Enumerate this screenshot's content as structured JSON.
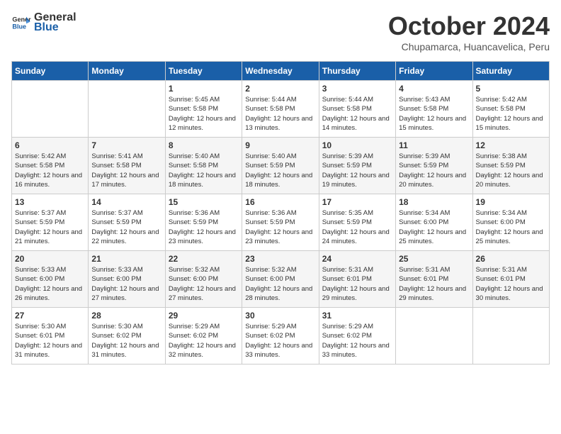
{
  "logo": {
    "general": "General",
    "blue": "Blue"
  },
  "title": "October 2024",
  "location": "Chupamarca, Huancavelica, Peru",
  "days_of_week": [
    "Sunday",
    "Monday",
    "Tuesday",
    "Wednesday",
    "Thursday",
    "Friday",
    "Saturday"
  ],
  "weeks": [
    [
      {
        "day": "",
        "sunrise": "",
        "sunset": "",
        "daylight": ""
      },
      {
        "day": "",
        "sunrise": "",
        "sunset": "",
        "daylight": ""
      },
      {
        "day": "1",
        "sunrise": "Sunrise: 5:45 AM",
        "sunset": "Sunset: 5:58 PM",
        "daylight": "Daylight: 12 hours and 12 minutes."
      },
      {
        "day": "2",
        "sunrise": "Sunrise: 5:44 AM",
        "sunset": "Sunset: 5:58 PM",
        "daylight": "Daylight: 12 hours and 13 minutes."
      },
      {
        "day": "3",
        "sunrise": "Sunrise: 5:44 AM",
        "sunset": "Sunset: 5:58 PM",
        "daylight": "Daylight: 12 hours and 14 minutes."
      },
      {
        "day": "4",
        "sunrise": "Sunrise: 5:43 AM",
        "sunset": "Sunset: 5:58 PM",
        "daylight": "Daylight: 12 hours and 15 minutes."
      },
      {
        "day": "5",
        "sunrise": "Sunrise: 5:42 AM",
        "sunset": "Sunset: 5:58 PM",
        "daylight": "Daylight: 12 hours and 15 minutes."
      }
    ],
    [
      {
        "day": "6",
        "sunrise": "Sunrise: 5:42 AM",
        "sunset": "Sunset: 5:58 PM",
        "daylight": "Daylight: 12 hours and 16 minutes."
      },
      {
        "day": "7",
        "sunrise": "Sunrise: 5:41 AM",
        "sunset": "Sunset: 5:58 PM",
        "daylight": "Daylight: 12 hours and 17 minutes."
      },
      {
        "day": "8",
        "sunrise": "Sunrise: 5:40 AM",
        "sunset": "Sunset: 5:58 PM",
        "daylight": "Daylight: 12 hours and 18 minutes."
      },
      {
        "day": "9",
        "sunrise": "Sunrise: 5:40 AM",
        "sunset": "Sunset: 5:59 PM",
        "daylight": "Daylight: 12 hours and 18 minutes."
      },
      {
        "day": "10",
        "sunrise": "Sunrise: 5:39 AM",
        "sunset": "Sunset: 5:59 PM",
        "daylight": "Daylight: 12 hours and 19 minutes."
      },
      {
        "day": "11",
        "sunrise": "Sunrise: 5:39 AM",
        "sunset": "Sunset: 5:59 PM",
        "daylight": "Daylight: 12 hours and 20 minutes."
      },
      {
        "day": "12",
        "sunrise": "Sunrise: 5:38 AM",
        "sunset": "Sunset: 5:59 PM",
        "daylight": "Daylight: 12 hours and 20 minutes."
      }
    ],
    [
      {
        "day": "13",
        "sunrise": "Sunrise: 5:37 AM",
        "sunset": "Sunset: 5:59 PM",
        "daylight": "Daylight: 12 hours and 21 minutes."
      },
      {
        "day": "14",
        "sunrise": "Sunrise: 5:37 AM",
        "sunset": "Sunset: 5:59 PM",
        "daylight": "Daylight: 12 hours and 22 minutes."
      },
      {
        "day": "15",
        "sunrise": "Sunrise: 5:36 AM",
        "sunset": "Sunset: 5:59 PM",
        "daylight": "Daylight: 12 hours and 23 minutes."
      },
      {
        "day": "16",
        "sunrise": "Sunrise: 5:36 AM",
        "sunset": "Sunset: 5:59 PM",
        "daylight": "Daylight: 12 hours and 23 minutes."
      },
      {
        "day": "17",
        "sunrise": "Sunrise: 5:35 AM",
        "sunset": "Sunset: 5:59 PM",
        "daylight": "Daylight: 12 hours and 24 minutes."
      },
      {
        "day": "18",
        "sunrise": "Sunrise: 5:34 AM",
        "sunset": "Sunset: 6:00 PM",
        "daylight": "Daylight: 12 hours and 25 minutes."
      },
      {
        "day": "19",
        "sunrise": "Sunrise: 5:34 AM",
        "sunset": "Sunset: 6:00 PM",
        "daylight": "Daylight: 12 hours and 25 minutes."
      }
    ],
    [
      {
        "day": "20",
        "sunrise": "Sunrise: 5:33 AM",
        "sunset": "Sunset: 6:00 PM",
        "daylight": "Daylight: 12 hours and 26 minutes."
      },
      {
        "day": "21",
        "sunrise": "Sunrise: 5:33 AM",
        "sunset": "Sunset: 6:00 PM",
        "daylight": "Daylight: 12 hours and 27 minutes."
      },
      {
        "day": "22",
        "sunrise": "Sunrise: 5:32 AM",
        "sunset": "Sunset: 6:00 PM",
        "daylight": "Daylight: 12 hours and 27 minutes."
      },
      {
        "day": "23",
        "sunrise": "Sunrise: 5:32 AM",
        "sunset": "Sunset: 6:00 PM",
        "daylight": "Daylight: 12 hours and 28 minutes."
      },
      {
        "day": "24",
        "sunrise": "Sunrise: 5:31 AM",
        "sunset": "Sunset: 6:01 PM",
        "daylight": "Daylight: 12 hours and 29 minutes."
      },
      {
        "day": "25",
        "sunrise": "Sunrise: 5:31 AM",
        "sunset": "Sunset: 6:01 PM",
        "daylight": "Daylight: 12 hours and 29 minutes."
      },
      {
        "day": "26",
        "sunrise": "Sunrise: 5:31 AM",
        "sunset": "Sunset: 6:01 PM",
        "daylight": "Daylight: 12 hours and 30 minutes."
      }
    ],
    [
      {
        "day": "27",
        "sunrise": "Sunrise: 5:30 AM",
        "sunset": "Sunset: 6:01 PM",
        "daylight": "Daylight: 12 hours and 31 minutes."
      },
      {
        "day": "28",
        "sunrise": "Sunrise: 5:30 AM",
        "sunset": "Sunset: 6:02 PM",
        "daylight": "Daylight: 12 hours and 31 minutes."
      },
      {
        "day": "29",
        "sunrise": "Sunrise: 5:29 AM",
        "sunset": "Sunset: 6:02 PM",
        "daylight": "Daylight: 12 hours and 32 minutes."
      },
      {
        "day": "30",
        "sunrise": "Sunrise: 5:29 AM",
        "sunset": "Sunset: 6:02 PM",
        "daylight": "Daylight: 12 hours and 33 minutes."
      },
      {
        "day": "31",
        "sunrise": "Sunrise: 5:29 AM",
        "sunset": "Sunset: 6:02 PM",
        "daylight": "Daylight: 12 hours and 33 minutes."
      },
      {
        "day": "",
        "sunrise": "",
        "sunset": "",
        "daylight": ""
      },
      {
        "day": "",
        "sunrise": "",
        "sunset": "",
        "daylight": ""
      }
    ]
  ]
}
